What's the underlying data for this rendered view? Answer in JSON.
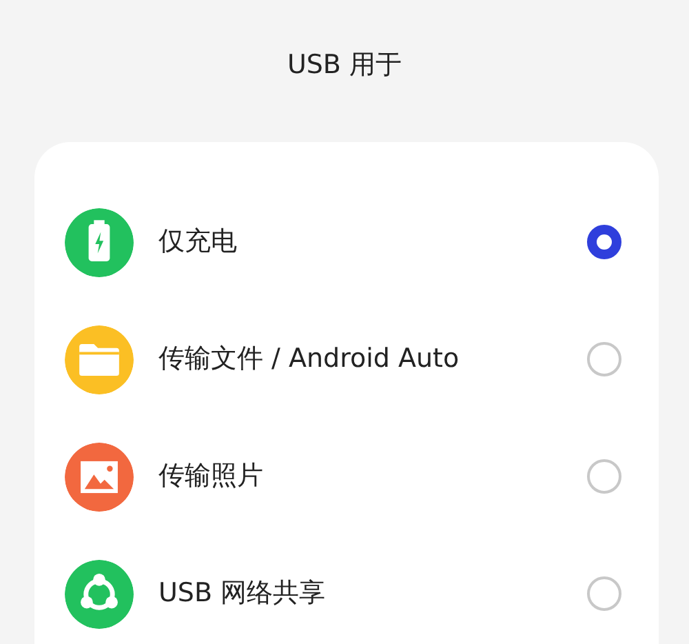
{
  "title": "USB 用于",
  "options": [
    {
      "label": "仅充电",
      "kind": "battery",
      "color": "#22c15e",
      "selected": true
    },
    {
      "label": "传输文件 / Android Auto",
      "kind": "folder",
      "color": "#fbbf24",
      "selected": false
    },
    {
      "label": "传输照片",
      "kind": "image",
      "color": "#f2683f",
      "selected": false
    },
    {
      "label": "USB 网络共享",
      "kind": "share",
      "color": "#22c15e",
      "selected": false
    }
  ]
}
